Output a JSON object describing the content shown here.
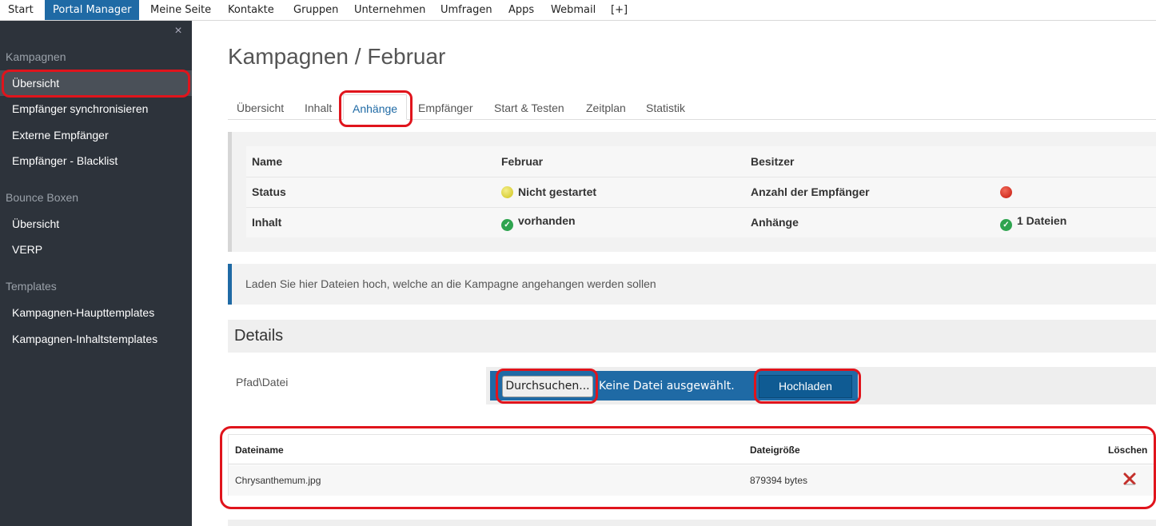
{
  "topnav": {
    "items": [
      "Start",
      "Portal Manager",
      "Meine Seite",
      "Kontakte",
      "Gruppen",
      "Unternehmen",
      "Umfragen",
      "Apps",
      "Webmail",
      "[+]"
    ]
  },
  "sidebar": {
    "close_label": "×",
    "sections": [
      {
        "title": "Kampagnen",
        "items": [
          "Übersicht",
          "Empfänger synchronisieren",
          "Externe Empfänger",
          "Empfänger - Blacklist"
        ]
      },
      {
        "title": "Bounce Boxen",
        "items": [
          "Übersicht",
          "VERP"
        ]
      },
      {
        "title": "Templates",
        "items": [
          "Kampagnen-Haupttemplates",
          "Kampagnen-Inhaltstemplates"
        ]
      }
    ]
  },
  "page": {
    "title": "Kampagnen / Februar"
  },
  "tabs": [
    "Übersicht",
    "Inhalt",
    "Anhänge",
    "Empfänger",
    "Start & Testen",
    "Zeitplan",
    "Statistik"
  ],
  "summary": {
    "rows": [
      {
        "k1": "Name",
        "v1": "Februar",
        "k2": "Besitzer",
        "v2": ""
      },
      {
        "k1": "Status",
        "v1": "Nicht gestartet",
        "k2": "Anzahl der Empfänger",
        "v2": ""
      },
      {
        "k1": "Inhalt",
        "v1": "vorhanden",
        "k2": "Anhänge",
        "v2": "1 Dateien"
      }
    ],
    "colors": {
      "yellow": "#d8cd2a",
      "red": "#d0231a",
      "green": "#2ea44f"
    }
  },
  "info": {
    "text": "Laden Sie hier Dateien hoch, welche an die Kampagne angehangen werden sollen"
  },
  "details": {
    "heading": "Details",
    "path_label": "Pfad\\Datei",
    "browse_label": "Durchsuchen...",
    "no_file_text": "Keine Datei ausgewählt.",
    "upload_label": "Hochladen"
  },
  "files": {
    "headers": [
      "Dateiname",
      "Dateigröße",
      "Löschen"
    ],
    "rows": [
      {
        "name": "Chrysanthemum.jpg",
        "size": "879394 bytes"
      }
    ]
  },
  "colors": {
    "accent": "#1f6aa5",
    "sidebar_bg": "#2d333b",
    "annotation": "#e0141c"
  }
}
